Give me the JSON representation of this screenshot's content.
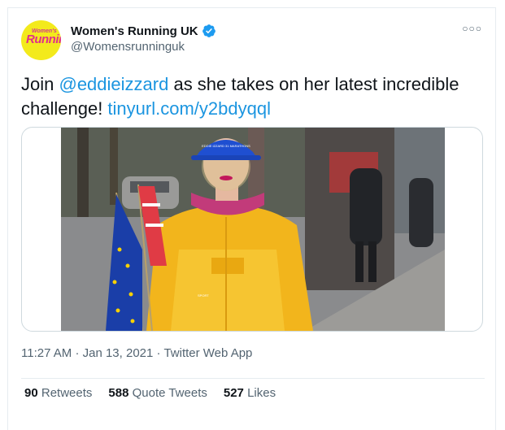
{
  "author": {
    "display_name": "Women's Running UK",
    "handle": "@Womensrunninguk",
    "avatar_text_top": "Women's",
    "avatar_text_main": "Running",
    "verified": true
  },
  "tweet": {
    "text_before": "Join ",
    "mention": "@eddieizzard",
    "text_middle": " as she takes on her latest incredible challenge! ",
    "link": "tinyurl.com/y2bdyqql"
  },
  "media": {
    "cap_text": "EDDIE IZZARD 31 MARATHONS",
    "jacket_text": "SPORT"
  },
  "meta": {
    "time": "11:27 AM",
    "separator": "·",
    "date": "Jan 13, 2021",
    "source": "Twitter Web App"
  },
  "stats": {
    "retweets_count": "90",
    "retweets_label": "Retweets",
    "quotes_count": "588",
    "quotes_label": "Quote Tweets",
    "likes_count": "527",
    "likes_label": "Likes"
  },
  "colors": {
    "link": "#1b95e0",
    "verified": "#1d9bf0",
    "secondary_text": "#536471",
    "avatar_bg": "#f3ea1c"
  }
}
